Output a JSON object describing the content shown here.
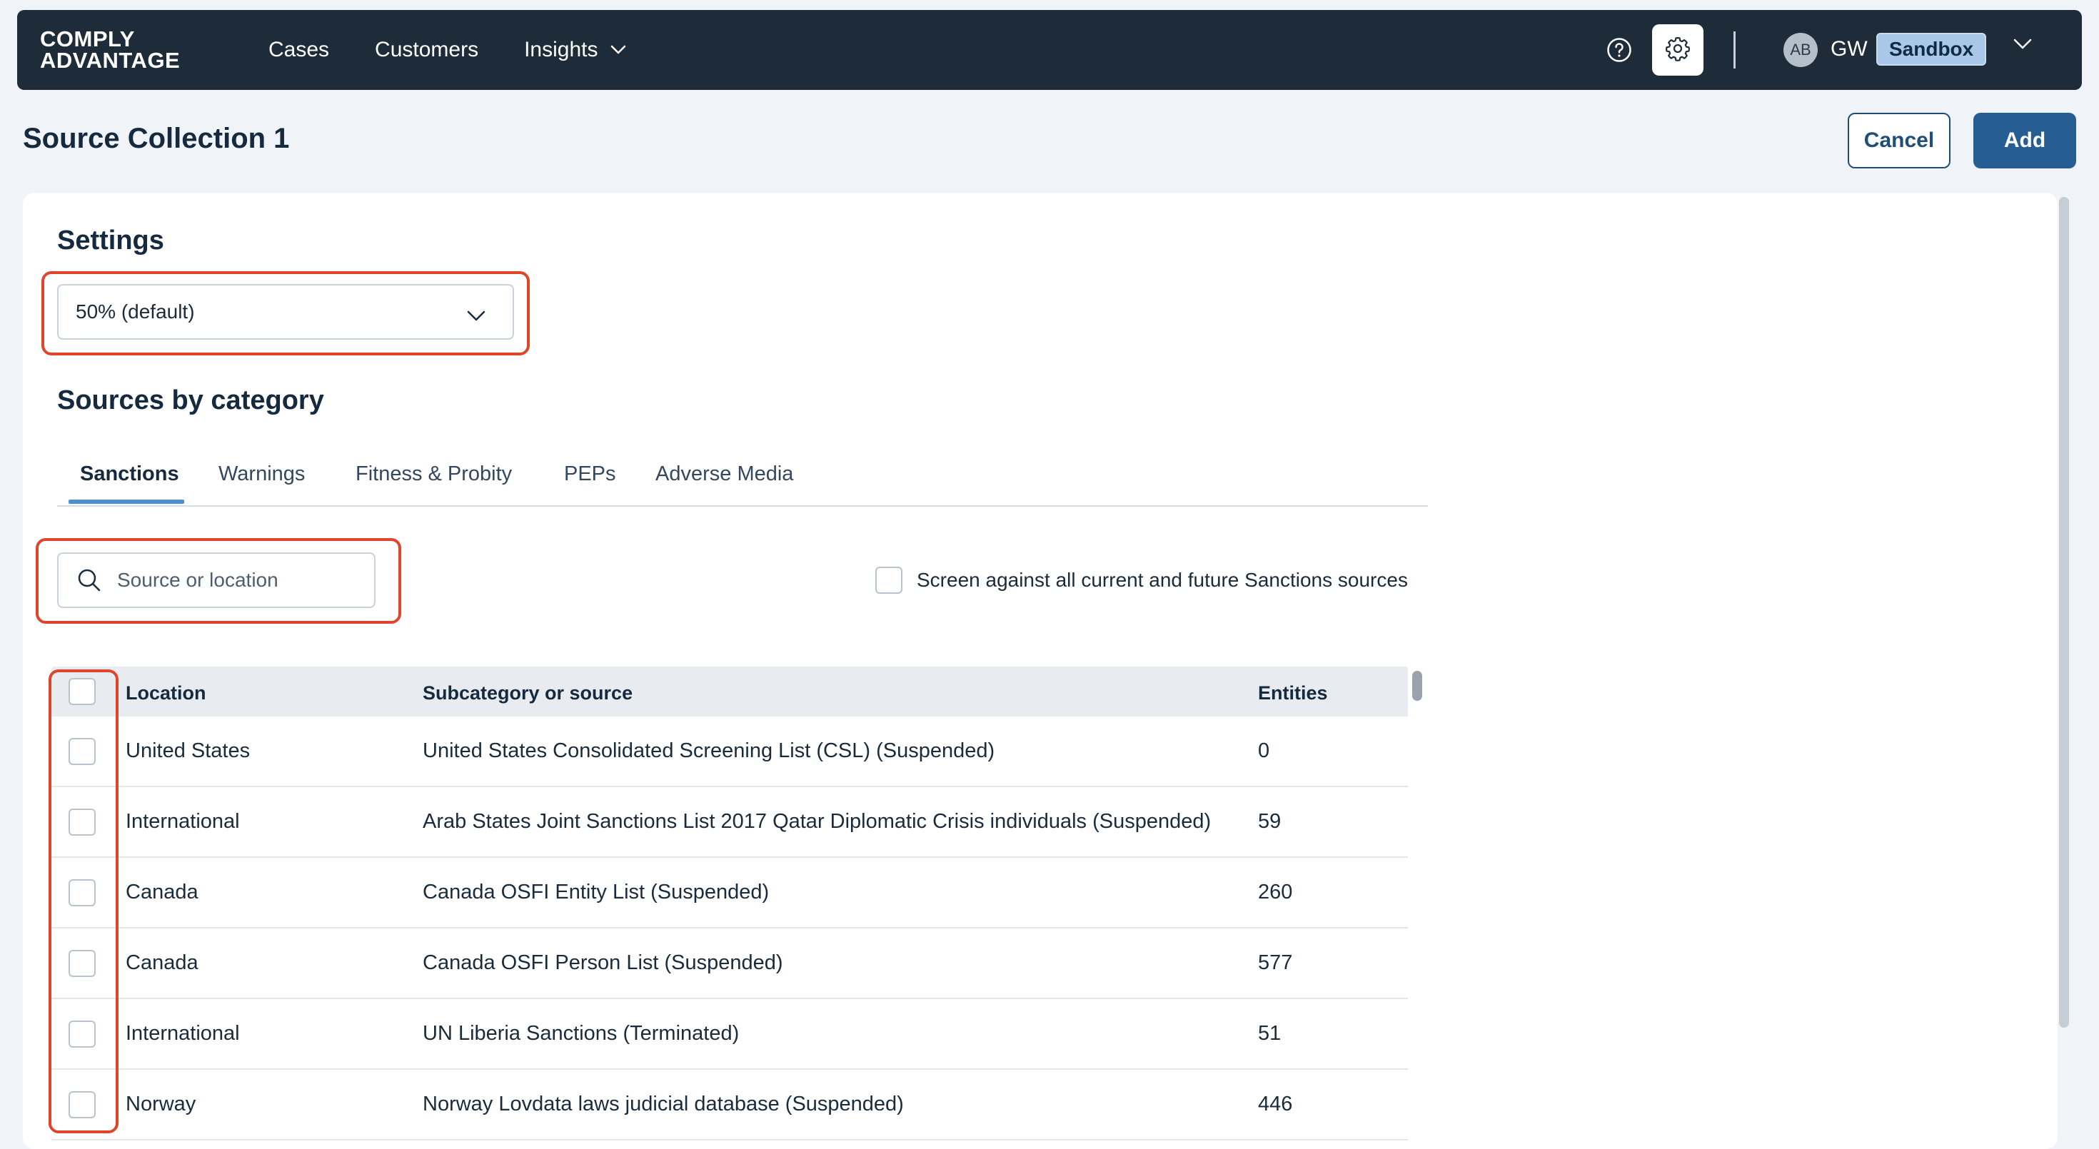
{
  "brand": {
    "line1": "COMPLY",
    "line2": "ADVANTAGE"
  },
  "nav": {
    "links": [
      {
        "label": "Cases"
      },
      {
        "label": "Customers"
      },
      {
        "label": "Insights"
      }
    ],
    "help_icon": "question-circle-icon",
    "settings_icon": "gear-icon",
    "user": {
      "avatar": "AB",
      "initials": "GW",
      "environment": "Sandbox"
    }
  },
  "header": {
    "title": "Source Collection 1",
    "cancel_label": "Cancel",
    "add_label": "Add"
  },
  "settings": {
    "title": "Settings",
    "threshold_value": "50% (default)"
  },
  "sources": {
    "title": "Sources by category",
    "tabs": [
      {
        "label": "Sanctions",
        "active": true
      },
      {
        "label": "Warnings"
      },
      {
        "label": "Fitness & Probity"
      },
      {
        "label": "PEPs"
      },
      {
        "label": "Adverse Media"
      }
    ],
    "search": {
      "placeholder": "Source or location",
      "value": ""
    },
    "screen_all_label": "Screen against all current and future Sanctions sources",
    "table": {
      "columns": [
        "Location",
        "Subcategory or source",
        "Entities"
      ],
      "rows": [
        {
          "location": "United States",
          "source": "United States Consolidated Screening List (CSL) (Suspended)",
          "entities": "0"
        },
        {
          "location": "International",
          "source": "Arab States Joint Sanctions List 2017 Qatar Diplomatic Crisis individuals (Suspended)",
          "entities": "59"
        },
        {
          "location": "Canada",
          "source": "Canada OSFI Entity List (Suspended)",
          "entities": "260"
        },
        {
          "location": "Canada",
          "source": "Canada OSFI Person List (Suspended)",
          "entities": "577"
        },
        {
          "location": "International",
          "source": "UN Liberia Sanctions (Terminated)",
          "entities": "51"
        },
        {
          "location": "Norway",
          "source": "Norway Lovdata laws judicial database (Suspended)",
          "entities": "446"
        }
      ]
    }
  },
  "colors": {
    "nav_bg": "#1e2b38",
    "primary": "#265d92",
    "highlight": "#e0452b",
    "tab_underline": "#4f8ed1",
    "badge_bg": "#a9c8e8"
  }
}
